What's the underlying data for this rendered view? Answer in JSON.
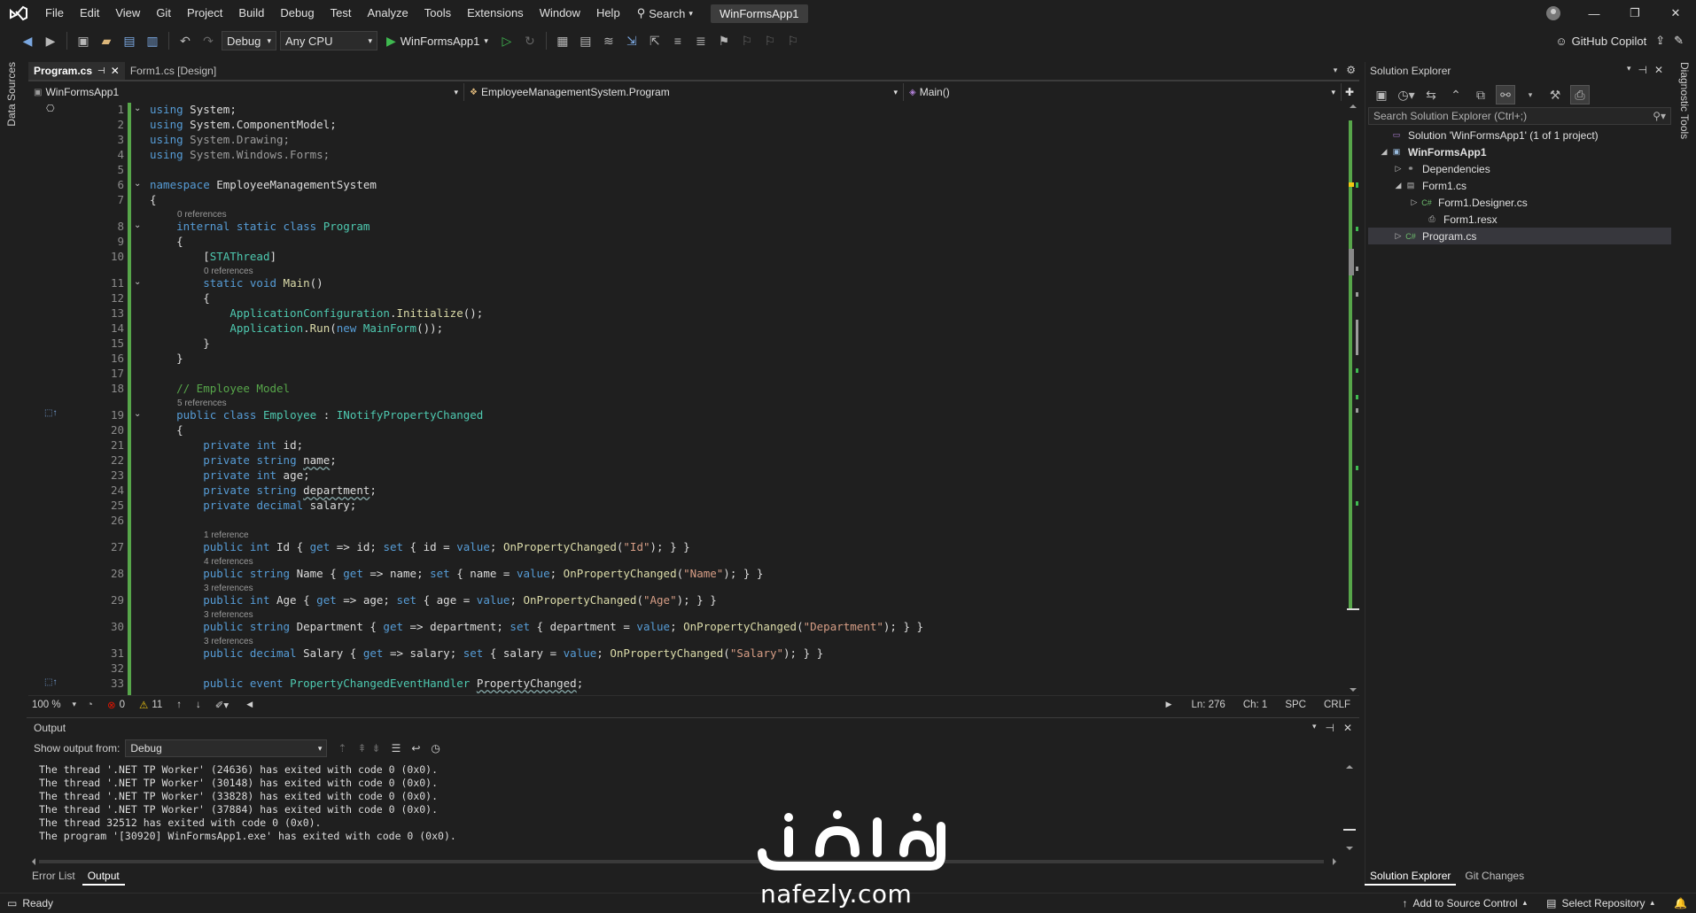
{
  "menubar": {
    "items": [
      "File",
      "Edit",
      "View",
      "Git",
      "Project",
      "Build",
      "Debug",
      "Test",
      "Analyze",
      "Tools",
      "Extensions",
      "Window",
      "Help"
    ],
    "search_label": "Search",
    "solution_name": "WinFormsApp1"
  },
  "toolbar": {
    "configuration": "Debug",
    "platform": "Any CPU",
    "start_target": "WinFormsApp1",
    "copilot_label": "GitHub Copilot"
  },
  "side_tabs": {
    "left": "Data Sources",
    "right": "Diagnostic Tools"
  },
  "doc_tabs": [
    {
      "label": "Program.cs",
      "active": true
    },
    {
      "label": "Form1.cs [Design]",
      "active": false
    }
  ],
  "navbar": {
    "project": "WinFormsApp1",
    "type": "EmployeeManagementSystem.Program",
    "member": "Main()"
  },
  "editor": {
    "line_numbers": [
      "1",
      "2",
      "3",
      "4",
      "5",
      "6",
      "7",
      "8",
      "9",
      "10",
      "11",
      "12",
      "13",
      "14",
      "15",
      "16",
      "17",
      "18",
      "19",
      "20",
      "21",
      "22",
      "23",
      "24",
      "25",
      "26",
      "27",
      "28",
      "29",
      "30",
      "31",
      "32",
      "33"
    ],
    "hints": {
      "h8": "0 references",
      "h11": "0 references",
      "h19": "5 references",
      "h27": "1 reference",
      "h28": "4 references",
      "h29": "3 references",
      "h30": "3 references",
      "h31": "3 references"
    }
  },
  "editor_status": {
    "zoom": "100 %",
    "errors": "0",
    "warnings": "11",
    "line": "Ln: 276",
    "col": "Ch: 1",
    "spacing": "SPC",
    "eol": "CRLF"
  },
  "output": {
    "title": "Output",
    "show_from_label": "Show output from:",
    "source": "Debug",
    "lines": [
      "The thread '.NET TP Worker' (24636) has exited with code 0 (0x0).",
      "The thread '.NET TP Worker' (30148) has exited with code 0 (0x0).",
      "The thread '.NET TP Worker' (33828) has exited with code 0 (0x0).",
      "The thread '.NET TP Worker' (37884) has exited with code 0 (0x0).",
      "The thread 32512 has exited with code 0 (0x0).",
      "The program '[30920] WinFormsApp1.exe' has exited with code 0 (0x0)."
    ]
  },
  "bottom_tabs": [
    "Error List",
    "Output"
  ],
  "solution_explorer": {
    "title": "Solution Explorer",
    "search_placeholder": "Search Solution Explorer (Ctrl+;)",
    "tree": [
      {
        "label": "Solution 'WinFormsApp1' (1 of 1 project)"
      },
      {
        "label": "WinFormsApp1"
      },
      {
        "label": "Dependencies"
      },
      {
        "label": "Form1.cs"
      },
      {
        "label": "Form1.Designer.cs"
      },
      {
        "label": "Form1.resx"
      },
      {
        "label": "Program.cs"
      }
    ],
    "tabs": [
      "Solution Explorer",
      "Git Changes"
    ]
  },
  "statusbar": {
    "ready": "Ready",
    "source_control": "Add to Source Control",
    "repository": "Select Repository"
  },
  "watermark": {
    "latin": "nafezly.com",
    "arabic": "نفذلي"
  },
  "colors": {
    "background": "#1f1f1f",
    "keyword": "#569cd6",
    "type": "#4ec9b0",
    "string": "#d69d85",
    "comment": "#57a64a",
    "method": "#dcdcaa",
    "change_bar": "#57a64a",
    "error_icon": "#e51400",
    "warning_icon": "#f2c811"
  }
}
